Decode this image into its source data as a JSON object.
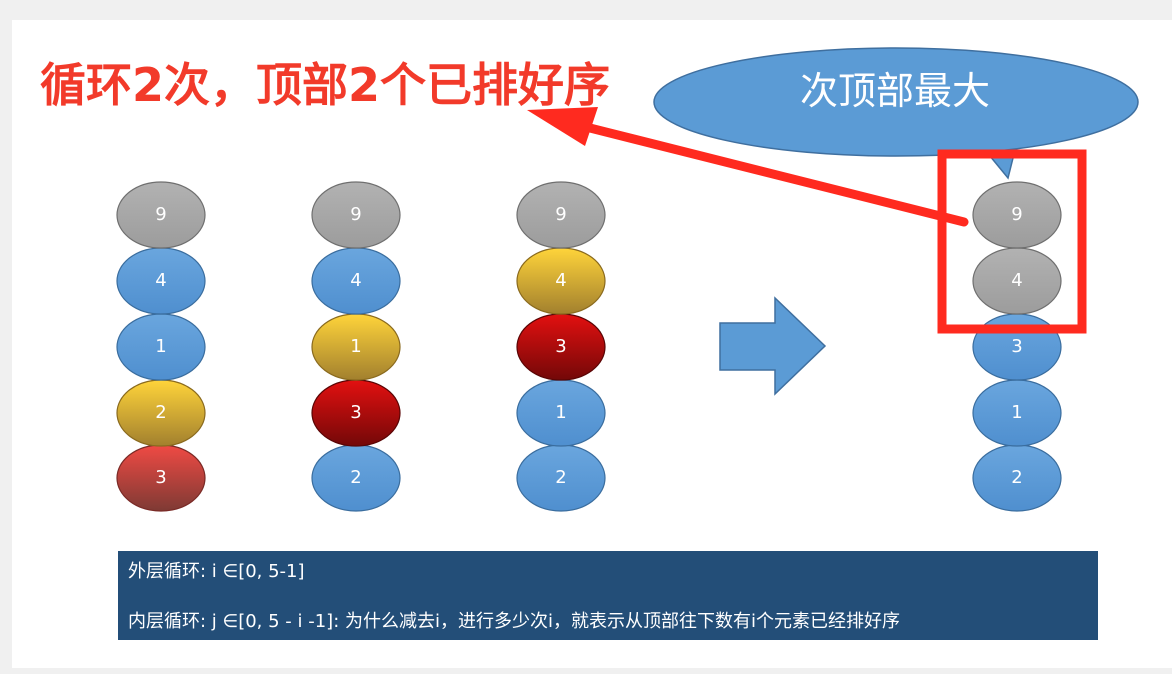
{
  "title": "循环2次，顶部2个已排好序",
  "callout": {
    "text": "次顶部最大",
    "color": "#5b9bd5"
  },
  "highlight_color": "#ff2a1f",
  "columns": [
    {
      "balls": [
        {
          "label": "9",
          "color": "gray"
        },
        {
          "label": "4",
          "color": "blue"
        },
        {
          "label": "1",
          "color": "blue"
        },
        {
          "label": "2",
          "color": "gold"
        },
        {
          "label": "3",
          "color": "red"
        }
      ]
    },
    {
      "balls": [
        {
          "label": "9",
          "color": "gray"
        },
        {
          "label": "4",
          "color": "blue"
        },
        {
          "label": "1",
          "color": "gold"
        },
        {
          "label": "3",
          "color": "darkred"
        },
        {
          "label": "2",
          "color": "blue"
        }
      ]
    },
    {
      "balls": [
        {
          "label": "9",
          "color": "gray"
        },
        {
          "label": "4",
          "color": "gold"
        },
        {
          "label": "3",
          "color": "darkred"
        },
        {
          "label": "1",
          "color": "blue"
        },
        {
          "label": "2",
          "color": "blue"
        }
      ]
    },
    {
      "balls": [
        {
          "label": "9",
          "color": "gray"
        },
        {
          "label": "4",
          "color": "gray"
        },
        {
          "label": "3",
          "color": "blue"
        },
        {
          "label": "1",
          "color": "blue"
        },
        {
          "label": "2",
          "color": "blue"
        }
      ]
    }
  ],
  "info": {
    "outer_loop": "外层循环:   i ∈[0, 5-1]",
    "inner_loop": "内层循环:   j ∈[0, 5 - i -1]: 为什么减去i，进行多少次i，就表示从顶部往下数有i个元素已经排好序"
  }
}
